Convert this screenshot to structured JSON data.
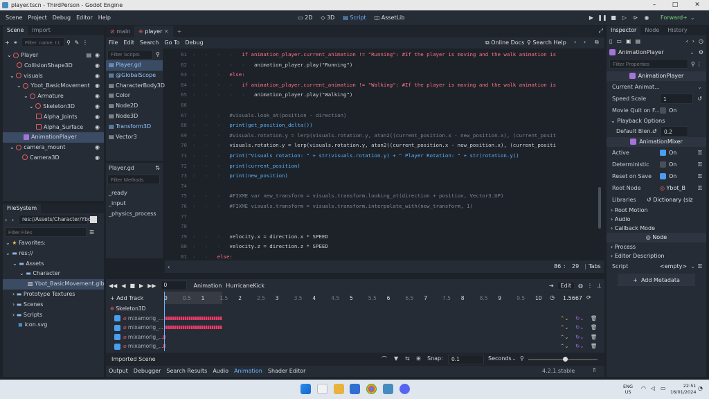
{
  "window": {
    "title": "player.tscn - ThirdPerson - Godot Engine"
  },
  "mainmenu": [
    "Scene",
    "Project",
    "Debug",
    "Editor",
    "Help"
  ],
  "workspaces": [
    "2D",
    "3D",
    "Script",
    "AssetLib"
  ],
  "renderer": "Forward+",
  "scene_dock": {
    "tabs": [
      "Scene",
      "Import"
    ],
    "filter_placeholder": "Filter: name, t:t",
    "nodes": [
      "Player",
      "CollisionShape3D",
      "visuals",
      "Ybot_BasicMovement",
      "Armature",
      "Skeleton3D",
      "Alpha_Joints",
      "Alpha_Surface",
      "AnimationPlayer",
      "camera_mount",
      "Camera3D"
    ]
  },
  "filesystem": {
    "tab": "FileSystem",
    "path": "res://Assets/Character/Ybot",
    "filter_placeholder": "Filter Files",
    "items": [
      "Favorites:",
      "res://",
      "Assets",
      "Character",
      "Ybot_BasicMovement.glb",
      "Prototype Textures",
      "Scenes",
      "Scripts",
      "icon.svg"
    ]
  },
  "script_tabs": [
    "main",
    "player"
  ],
  "script_menu": [
    "File",
    "Edit",
    "Search",
    "Go To",
    "Debug"
  ],
  "script_links": {
    "docs": "Online Docs",
    "search_help": "Search Help"
  },
  "scripts_filter": "Filter Scripts",
  "scripts_list": [
    "Player.gd",
    "@GlobalScope",
    "CharacterBody3D",
    "Color",
    "Node2D",
    "Node3D",
    "Transform3D",
    "Vector3"
  ],
  "methods": {
    "title": "Player.gd",
    "filter": "Filter Methods",
    "items": [
      "_ready",
      "_input",
      "_physics_process"
    ]
  },
  "code_lines": [
    {
      "n": "61",
      "text": "if animation_player.current_animation != \"Running\": #If the player is moving and the walk animation is"
    },
    {
      "n": "62",
      "text": "animation_player.play(\"Running\")"
    },
    {
      "n": "63",
      "text": "else:"
    },
    {
      "n": "64",
      "text": "if animation_player.current_animation != \"Walking\": #If the player is moving and the walk animation is"
    },
    {
      "n": "65",
      "text": "animation_player.play(\"Walking\")"
    },
    {
      "n": "66",
      "text": ""
    },
    {
      "n": "67",
      "text": "#visuals.look_at(position - direction)"
    },
    {
      "n": "68",
      "text": "print(get_position_delta())"
    },
    {
      "n": "69",
      "text": "#visuals.rotation.y = lerp(visuals.rotation.y, atan2((current_position.x - new_position.x), (current_posit"
    },
    {
      "n": "70",
      "text": "visuals.rotation.y = lerp(visuals.rotation.y, atan2((current_position.x - new_position.x), (current_positi"
    },
    {
      "n": "71",
      "text": "print(\"Visuals rotation: \" + str(visuals.rotation.y) + \" Player Rotation: \" + str(rotation.y))"
    },
    {
      "n": "72",
      "text": "print(current_position)"
    },
    {
      "n": "73",
      "text": "print(new_position)"
    },
    {
      "n": "74",
      "text": ""
    },
    {
      "n": "75",
      "text": "#FIXME var new_transform = visuals.transform.looking_at(direction + position, Vector3.UP)"
    },
    {
      "n": "76",
      "text": "#FIXME visuals.transform = visuals.transform.interpolate_with(new_transform, 1)"
    },
    {
      "n": "77",
      "text": ""
    },
    {
      "n": "78",
      "text": ""
    },
    {
      "n": "79",
      "text": "velocity.x = direction.x * SPEED"
    },
    {
      "n": "80",
      "text": "velocity.z = direction.z * SPEED"
    },
    {
      "n": "81",
      "text": "else:"
    },
    {
      "n": "82",
      "text": "if animation_player.current_animation != \"Idle\": #If the player is NOT moving and the Idle animation is NO"
    },
    {
      "n": "83",
      "text": "animation_player.play(\"Idle\")"
    }
  ],
  "cursor": {
    "line": "86",
    "col": "29",
    "indent": "Tabs"
  },
  "inspector": {
    "tabs": [
      "Inspector",
      "Node",
      "History"
    ],
    "node": "AnimationPlayer",
    "filter": "Filter Properties",
    "class": "AnimationPlayer",
    "props": {
      "current_anim": "Current Animat...",
      "speed_scale_label": "Speed Scale",
      "speed_scale": "1",
      "movie_quit": "Movie Quit on F...",
      "movie_quit_val": "On",
      "playback": "Playback Options",
      "default_blend": "Default Blen...",
      "default_blend_val": "0.2",
      "mixer": "AnimationMixer",
      "active": "Active",
      "on": "On",
      "deterministic": "Deterministic",
      "reset": "Reset on Save",
      "root_node": "Root Node",
      "root_node_val": "Ybot_B",
      "libraries": "Libraries",
      "libraries_val": "Dictionary (siz",
      "root_motion": "Root Motion",
      "audio": "Audio",
      "callback": "Callback Mode",
      "node_sect": "Node",
      "process": "Process",
      "editor_desc": "Editor Description",
      "script": "Script",
      "script_val": "<empty>",
      "add_meta": "Add Metadata"
    }
  },
  "animation": {
    "time": "0",
    "label": "Animation",
    "current": "HurricaneKick",
    "edit": "Edit",
    "add_track": "+ Add Track",
    "length": "1.5667",
    "ticks": [
      "0",
      "0.5",
      "1",
      "1.5",
      "2",
      "2.5",
      "3",
      "3.5",
      "4",
      "4.5",
      "5",
      "5.5",
      "6",
      "6.5",
      "7",
      "7.5",
      "8",
      "8.5",
      "9",
      "9.5",
      "10"
    ],
    "root": "Skeleton3D",
    "tracks": [
      "mixamorig_...",
      "mixamorig_...",
      "mixamorig_...",
      "mixamorig_..."
    ],
    "imported": "Imported Scene",
    "snap_label": "Snap:",
    "snap": "0.1",
    "unit": "Seconds"
  },
  "bottom_tabs": [
    "Output",
    "Debugger",
    "Search Results",
    "Audio",
    "Animation",
    "Shader Editor"
  ],
  "version": "4.2.1.stable",
  "taskbar": {
    "lang": "ENG",
    "region": "US",
    "time": "22:51",
    "date": "16/01/2024"
  }
}
